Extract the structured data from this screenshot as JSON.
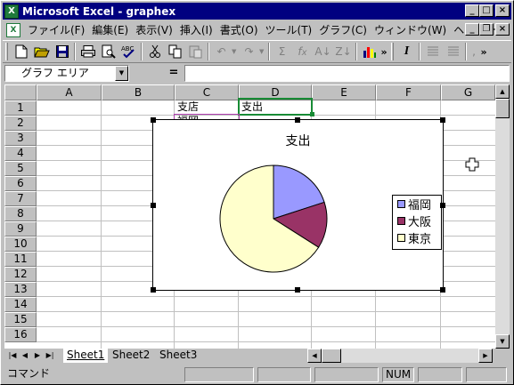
{
  "window": {
    "title": "Microsoft Excel - graphex",
    "app_icon": "X",
    "doc_icon": "X"
  },
  "menu": [
    {
      "label": "ファイル(F)"
    },
    {
      "label": "編集(E)"
    },
    {
      "label": "表示(V)"
    },
    {
      "label": "挿入(I)"
    },
    {
      "label": "書式(O)"
    },
    {
      "label": "ツール(T)"
    },
    {
      "label": "グラフ(C)"
    },
    {
      "label": "ウィンドウ(W)"
    },
    {
      "label": "ヘルプ(H)"
    }
  ],
  "toolbar": {
    "overflow_label": "»",
    "font_italic": "I",
    "comma": ","
  },
  "namebox": {
    "value": "グラフ エリア",
    "eq": "="
  },
  "columns": [
    "A",
    "B",
    "C",
    "D",
    "E",
    "F",
    "G"
  ],
  "rows": [
    "1",
    "2",
    "3",
    "4",
    "5",
    "6",
    "7",
    "8",
    "9",
    "10",
    "11",
    "12",
    "13",
    "14",
    "15",
    "16"
  ],
  "cells": {
    "C1": "支店",
    "D1": "支出",
    "C2": "福岡"
  },
  "chart_data": {
    "type": "pie",
    "title": "支出",
    "categories": [
      "福岡",
      "大阪",
      "東京"
    ],
    "values": [
      20,
      14,
      66
    ],
    "colors": [
      "#9999ff",
      "#993366",
      "#ffffcc"
    ],
    "legend": "right"
  },
  "sheet_tabs": [
    {
      "label": "Sheet1",
      "active": true
    },
    {
      "label": "Sheet2",
      "active": false
    },
    {
      "label": "Sheet3",
      "active": false
    }
  ],
  "status": {
    "mode": "コマンド",
    "num": "NUM"
  }
}
